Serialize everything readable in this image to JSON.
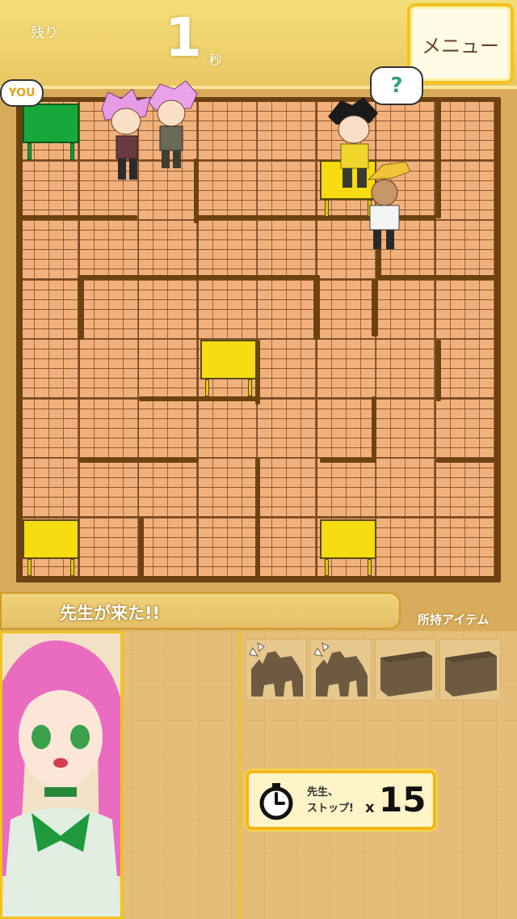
{
  "header": {
    "remain_label": "残り",
    "remain_seconds": "1",
    "seconds_unit": "秒",
    "menu_label": "メニュー"
  },
  "board": {
    "you_badge": "YOU",
    "teacher_bubble": "?"
  },
  "message": {
    "text": "先生が来た!!"
  },
  "items": {
    "label": "所持アイテム",
    "slots": [
      "item-silhouette",
      "item-silhouette",
      "item-box",
      "item-box"
    ]
  },
  "stop_item": {
    "label_line1": "先生、",
    "label_line2": "ストップ!",
    "multiplier": "x",
    "count": "15"
  },
  "icons": [
    "stopwatch-icon",
    "question-icon"
  ],
  "colors": {
    "header": "#f0d470",
    "accent": "#f2c21c",
    "wall": "#6d4210",
    "floor": "#f2b17c",
    "desk_yellow": "#f6dc10",
    "desk_green": "#16a83a"
  }
}
